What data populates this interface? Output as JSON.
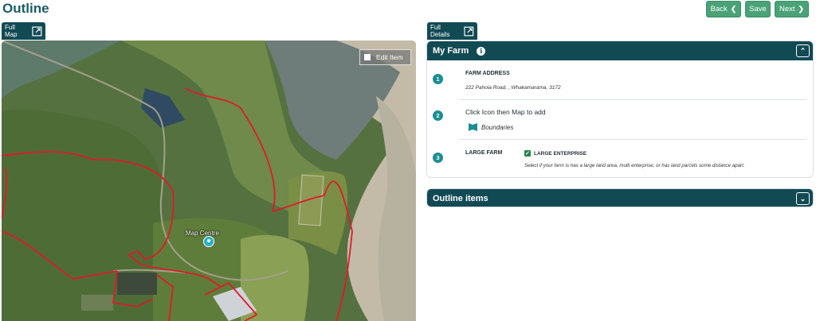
{
  "header": {
    "title": "Outline",
    "buttons": {
      "back": "Back",
      "save": "Save",
      "next": "Next"
    }
  },
  "map_panel": {
    "tab_label": "Full Map",
    "edit_item_label": "Edit Item",
    "map_centre_label": "Map Centre"
  },
  "details_panel": {
    "tab_label": "Full Details",
    "my_farm": {
      "title": "My Farm",
      "steps": [
        {
          "number": "1",
          "label": "FARM ADDRESS",
          "value": "222 Pahoia Road, , Whakamarama, 3172"
        },
        {
          "number": "2",
          "label": "Click Icon then Map to add",
          "item": "Boundaries"
        },
        {
          "number": "3",
          "label": "LARGE FARM",
          "checkbox_label": "LARGE ENTERPRISE",
          "checked": true,
          "hint": "Select if your farm is has a large land area, multi enterprise, or has land parcels some distance apart."
        }
      ]
    },
    "outline_items": {
      "title": "Outline items"
    }
  },
  "colors": {
    "primary_dark": "#124a54",
    "button_green": "#4aa277",
    "step_teal": "#1c8d92",
    "boundary_red": "#e0192b"
  }
}
